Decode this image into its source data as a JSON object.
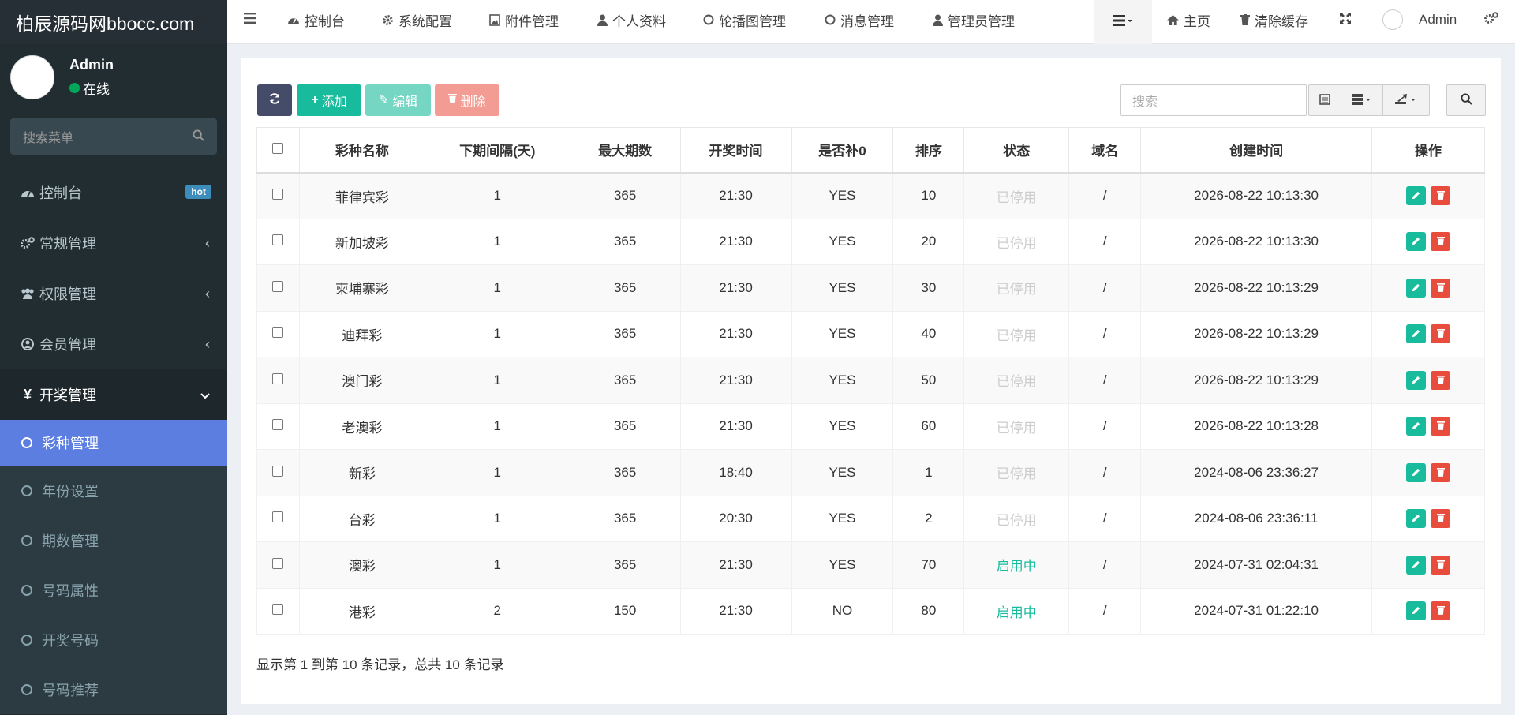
{
  "brand": {
    "logo": "柏辰源码网bbocc.com"
  },
  "user": {
    "name": "Admin",
    "status": "在线"
  },
  "sidebar": {
    "search_placeholder": "搜索菜单",
    "items": [
      {
        "label": "控制台",
        "badge": "hot"
      },
      {
        "label": "常规管理"
      },
      {
        "label": "权限管理"
      },
      {
        "label": "会员管理"
      },
      {
        "label": "开奖管理"
      }
    ],
    "subitems": [
      "彩种管理",
      "年份设置",
      "期数管理",
      "号码属性",
      "开奖号码",
      "号码推荐"
    ]
  },
  "topnav": {
    "items": [
      "控制台",
      "系统配置",
      "附件管理",
      "个人资料",
      "轮播图管理",
      "消息管理",
      "管理员管理"
    ],
    "home": "主页",
    "clear_cache": "清除缓存",
    "admin": "Admin"
  },
  "toolbar": {
    "add": "添加",
    "edit": "编辑",
    "delete": "删除",
    "search_placeholder": "搜索"
  },
  "table": {
    "headers": [
      "彩种名称",
      "下期间隔(天)",
      "最大期数",
      "开奖时间",
      "是否补0",
      "排序",
      "状态",
      "域名",
      "创建时间",
      "操作"
    ],
    "rows": [
      {
        "name": "菲律宾彩",
        "interval": "1",
        "max": "365",
        "time": "21:30",
        "pad": "YES",
        "sort": "10",
        "status": "已停用",
        "domain": "/",
        "created": "2026-08-22 10:13:30"
      },
      {
        "name": "新加坡彩",
        "interval": "1",
        "max": "365",
        "time": "21:30",
        "pad": "YES",
        "sort": "20",
        "status": "已停用",
        "domain": "/",
        "created": "2026-08-22 10:13:30"
      },
      {
        "name": "柬埔寨彩",
        "interval": "1",
        "max": "365",
        "time": "21:30",
        "pad": "YES",
        "sort": "30",
        "status": "已停用",
        "domain": "/",
        "created": "2026-08-22 10:13:29"
      },
      {
        "name": "迪拜彩",
        "interval": "1",
        "max": "365",
        "time": "21:30",
        "pad": "YES",
        "sort": "40",
        "status": "已停用",
        "domain": "/",
        "created": "2026-08-22 10:13:29"
      },
      {
        "name": "澳门彩",
        "interval": "1",
        "max": "365",
        "time": "21:30",
        "pad": "YES",
        "sort": "50",
        "status": "已停用",
        "domain": "/",
        "created": "2026-08-22 10:13:29"
      },
      {
        "name": "老澳彩",
        "interval": "1",
        "max": "365",
        "time": "21:30",
        "pad": "YES",
        "sort": "60",
        "status": "已停用",
        "domain": "/",
        "created": "2026-08-22 10:13:28"
      },
      {
        "name": "新彩",
        "interval": "1",
        "max": "365",
        "time": "18:40",
        "pad": "YES",
        "sort": "1",
        "status": "已停用",
        "domain": "/",
        "created": "2024-08-06 23:36:27"
      },
      {
        "name": "台彩",
        "interval": "1",
        "max": "365",
        "time": "20:30",
        "pad": "YES",
        "sort": "2",
        "status": "已停用",
        "domain": "/",
        "created": "2024-08-06 23:36:11"
      },
      {
        "name": "澳彩",
        "interval": "1",
        "max": "365",
        "time": "21:30",
        "pad": "YES",
        "sort": "70",
        "status": "启用中",
        "domain": "/",
        "created": "2024-07-31 02:04:31"
      },
      {
        "name": "港彩",
        "interval": "2",
        "max": "150",
        "time": "21:30",
        "pad": "NO",
        "sort": "80",
        "status": "启用中",
        "domain": "/",
        "created": "2024-07-31 01:22:10"
      }
    ]
  },
  "pagination": {
    "info": "显示第 1 到第 10 条记录，总共 10 条记录"
  },
  "colors": {
    "accent": "#5c7ee0",
    "success": "#18bc9c",
    "danger": "#e74c3c",
    "sidebar": "#222d32"
  }
}
